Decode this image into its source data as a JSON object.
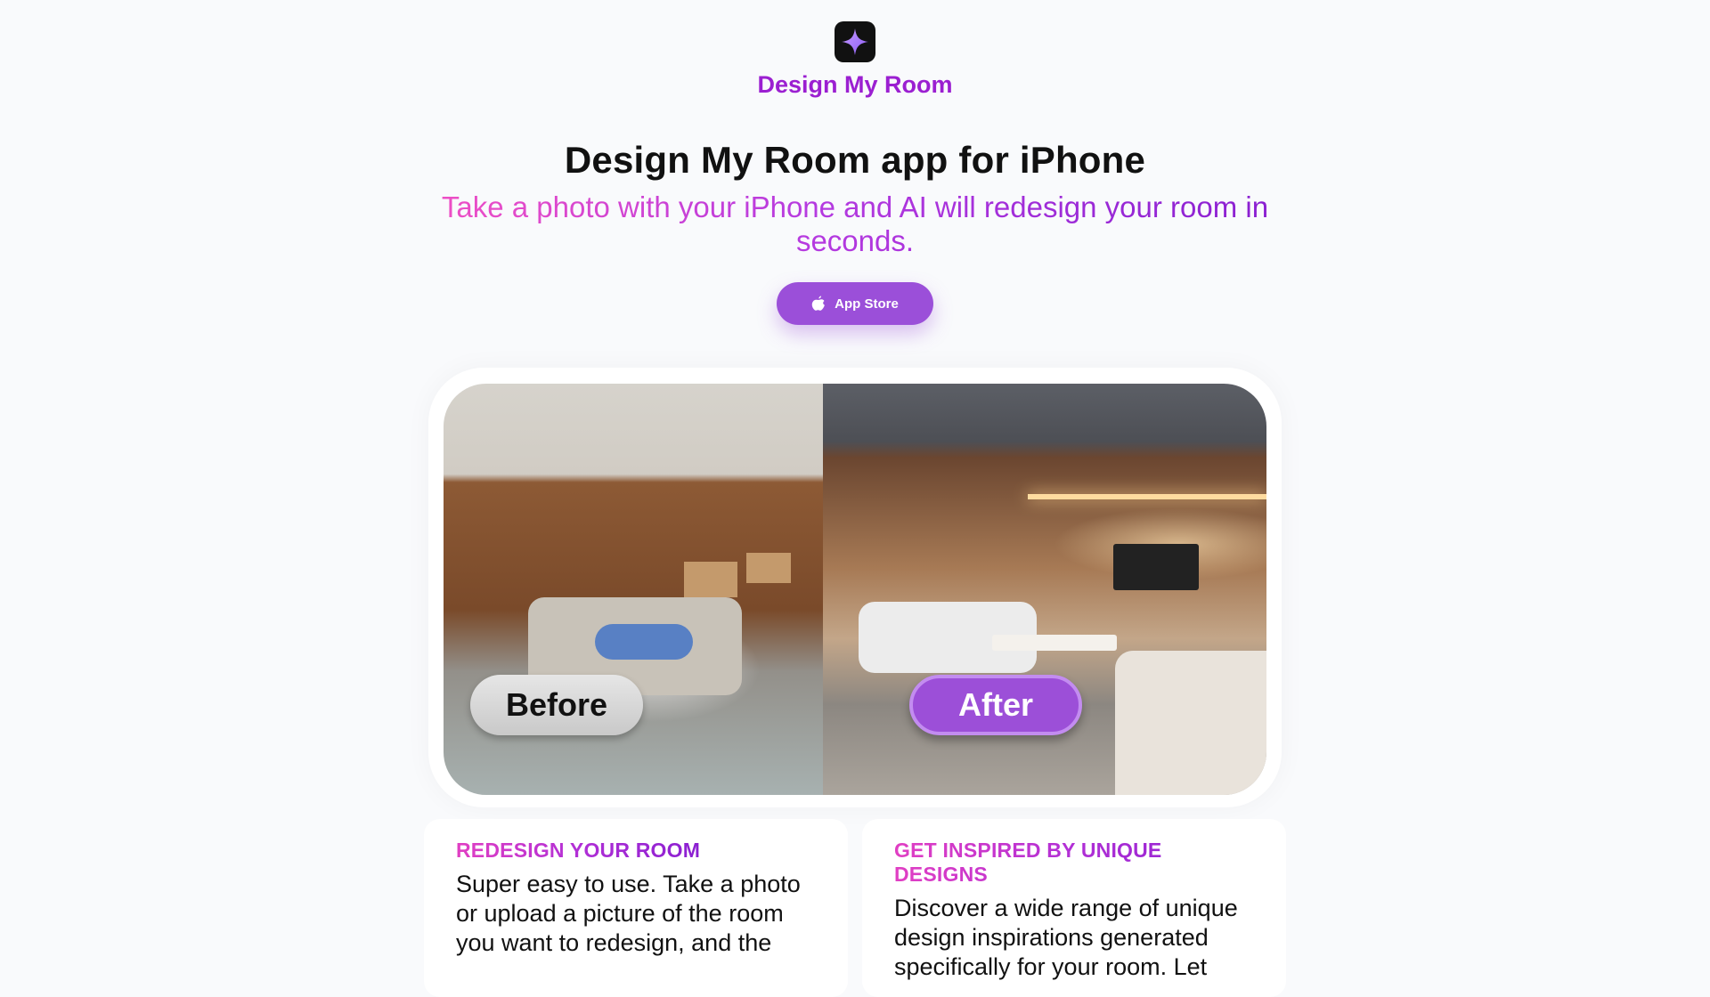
{
  "header": {
    "brand": "Design My Room",
    "logo_icon": "sparkle-icon"
  },
  "hero": {
    "title": "Design My Room app for iPhone",
    "tagline": "Take a photo with your iPhone and AI will redesign your room in seconds."
  },
  "cta": {
    "label": "App Store",
    "icon": "apple-icon",
    "color": "#9b4fd9"
  },
  "comparison": {
    "before_label": "Before",
    "after_label": "After",
    "accent": "#9c4fd8"
  },
  "features": [
    {
      "title": "REDESIGN YOUR ROOM",
      "body": "Super easy to use. Take a photo or upload a picture of the room you want to redesign, and the"
    },
    {
      "title": "GET INSPIRED BY UNIQUE DESIGNS",
      "body": "Discover a wide range of unique design inspirations generated specifically for your room. Let"
    }
  ],
  "colors": {
    "brand": "#9b1fd1",
    "gradient_start": "#ee4fc5",
    "gradient_end": "#8a1fd1",
    "background": "#f9fafc"
  }
}
